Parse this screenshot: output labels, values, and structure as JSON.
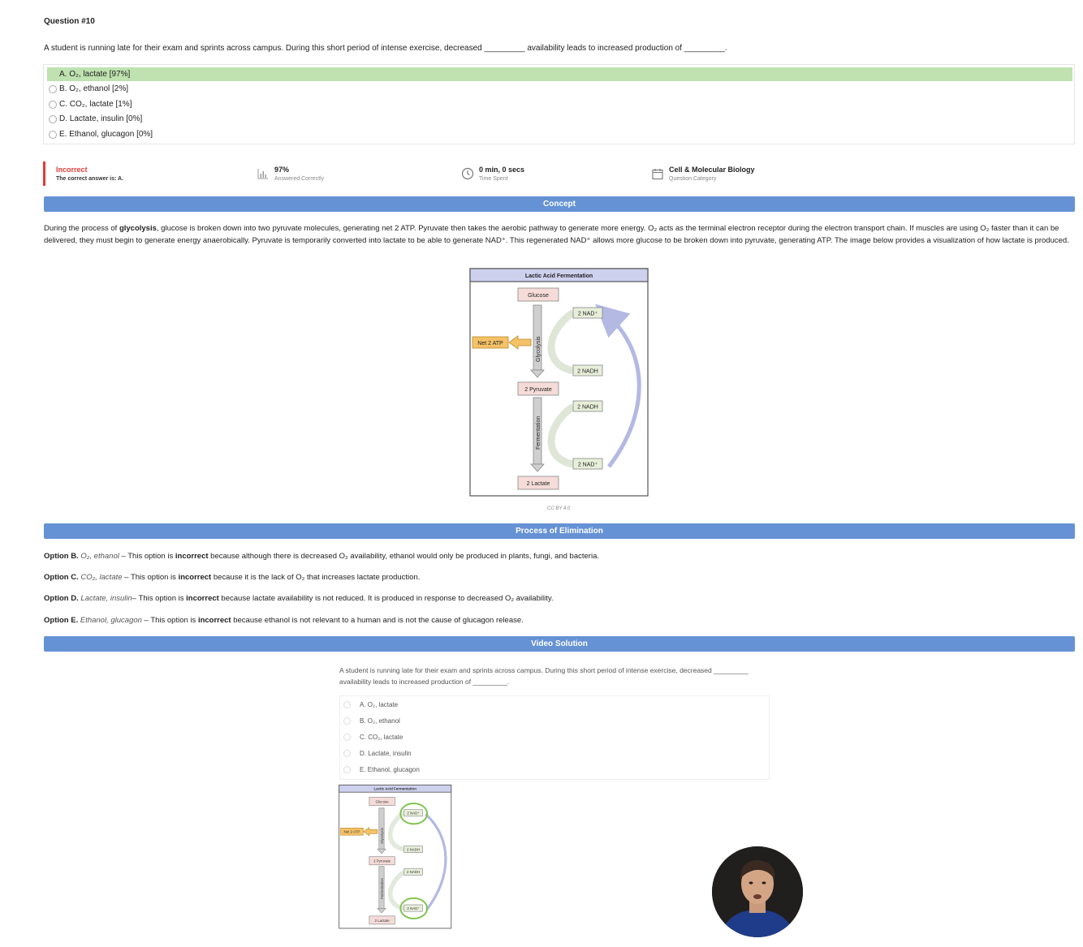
{
  "question": {
    "title": "Question #10",
    "text": "A student is running late for their exam and sprints across campus. During this short period of intense exercise, decreased _________ availability leads to increased production of _________."
  },
  "choices": [
    {
      "label": "A. O₂, lactate [97%]",
      "correct": true
    },
    {
      "label": "B. O₂, ethanol [2%]",
      "correct": false
    },
    {
      "label": "C. CO₂, lactate [1%]",
      "correct": false
    },
    {
      "label": "D. Lactate, insulin [0%]",
      "correct": false
    },
    {
      "label": "E. Ethanol, glucagon [0%]",
      "correct": false
    }
  ],
  "stats": {
    "result": "Incorrect",
    "correct_answer": "The correct answer is: A.",
    "percent": "97%",
    "percent_label": "Answered Correctly",
    "time": "0 min, 0 secs",
    "time_label": "Time Spent",
    "category": "Cell & Molecular Biology",
    "category_label": "Question Category"
  },
  "sections": {
    "concept": "Concept",
    "elimination": "Process of Elimination",
    "video": "Video Solution"
  },
  "concept": {
    "p1": "During the process of ",
    "glycolysis": "glycolysis",
    "p2": ", glucose is broken down into two pyruvate molecules, generating net 2 ATP. Pyruvate then takes the aerobic pathway to generate more energy. O₂ acts as the terminal electron receptor during the electron transport chain. If muscles are using O₂ faster than it can be delivered, they must begin to generate energy anaerobically. Pyruvate is temporarily converted into lactate to be able to generate NAD⁺. This regenerated NAD⁺ allows more glucose to be broken down into pyruvate, generating ATP. The image below provides a visualization of how lactate is produced."
  },
  "diagram": {
    "title": "Lactic Acid Fermentation",
    "glucose": "Glucose",
    "pyruvate": "2 Pyruvate",
    "lactate": "2 Lactate",
    "atp": "Net 2 ATP",
    "glycolysis": "Glycolysis",
    "fermentation": "Fermentation",
    "nad_top": "2 NAD⁺",
    "nadh_1": "2 NADH",
    "nadh_2": "2 NADH",
    "nad_bottom": "2 NAD⁺",
    "credit": "CC BY 4.0"
  },
  "elimination": [
    {
      "option": "Option B.",
      "answer": "O₂, ethanol",
      "pre": " – This option is ",
      "bold": "incorrect",
      "post": " because although there is decreased O₂ availability, ethanol would only be produced in plants, fungi, and bacteria."
    },
    {
      "option": "Option C.",
      "answer": "CO₂, lactate",
      "pre": " – This option is ",
      "bold": "incorrect",
      "post": " because it is the lack of O₂ that increases lactate production."
    },
    {
      "option": "Option D.",
      "answer": "Lactate, insulin",
      "pre": "– This option is ",
      "bold": "incorrect",
      "post": " because lactate availability is not reduced. It is produced in response to decreased O₂ availability."
    },
    {
      "option": "Option E.",
      "answer": "Ethanol, glucagon",
      "pre": " – This option is ",
      "bold": "incorrect",
      "post": " because ethanol is not relevant to a human and is not the cause of glucagon release."
    }
  ],
  "video": {
    "question": "A student is running late for their exam and sprints across campus. During this short period of intense exercise, decreased _________ availability leads to increased production of _________.",
    "choices": [
      "A. O₂, lactate",
      "B. O₂, ethanol",
      "C. CO₂, lactate",
      "D. Lactate, insulin",
      "E. Ethanol, glucagon"
    ]
  },
  "colors": {
    "correct_bg": "#bfe2b0",
    "section_bar": "#6592d4",
    "incorrect": "#e53935"
  }
}
